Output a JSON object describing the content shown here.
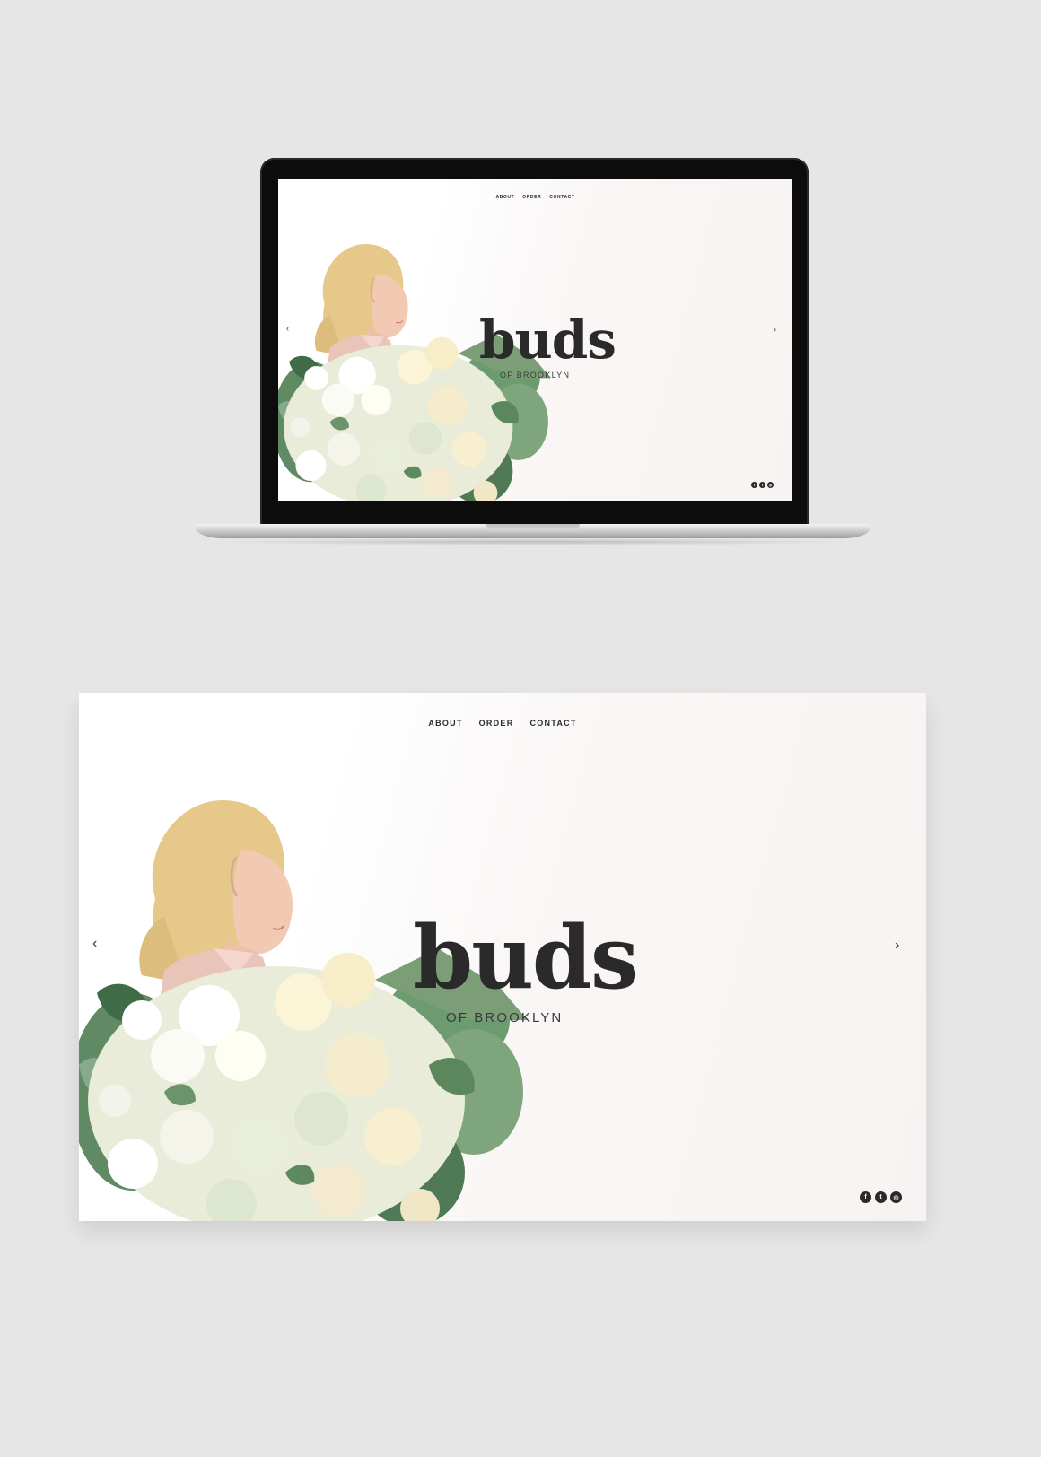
{
  "site": {
    "nav": [
      "ABOUT",
      "ORDER",
      "CONTACT"
    ],
    "logo_title": "buds",
    "logo_subtitle": "OF BROOKLYN",
    "arrow_prev": "‹",
    "arrow_next": "›",
    "socials": [
      {
        "icon": "facebook-icon",
        "glyph": "f"
      },
      {
        "icon": "twitter-icon",
        "glyph": "t"
      },
      {
        "icon": "instagram-icon",
        "glyph": "◎"
      }
    ]
  },
  "colors": {
    "page_bg": "#e6e6e6",
    "text_dark": "#2a2a2a",
    "site_bg": "#f7f3f2",
    "laptop_bezel": "#0c0c0c"
  }
}
